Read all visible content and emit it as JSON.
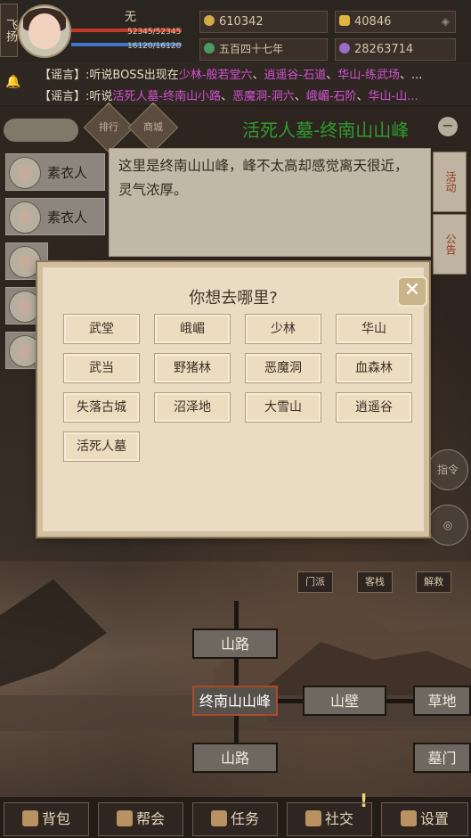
{
  "player": {
    "tag": "飞扬",
    "name": "无",
    "hp_text": "52345/52345",
    "mp_text": "16120/16120",
    "hp_fraction": 1.0,
    "mp_fraction": 1.0
  },
  "currencies": {
    "coins": "610342",
    "ingots": "40846",
    "date": "五百四十七年",
    "points": "28263714"
  },
  "rumors": [
    {
      "prefix": "【谣言】:听说BOSS出现在",
      "locs": [
        "少林-般若堂六",
        "逍遥谷-石道",
        "华山-练武场"
      ],
      "suffix": "、..."
    },
    {
      "prefix": "【谣言】:听说",
      "locs": [
        "活死人墓-终南山小路",
        "恶魔洞-洞六",
        "峨嵋-石阶",
        "华山-山..."
      ],
      "suffix": ""
    }
  ],
  "nav": {
    "ranking": "排行",
    "shop": "商城"
  },
  "location_title": "活死人墓-终南山山峰",
  "npcs": [
    "素衣人",
    "素衣人"
  ],
  "description": "这里是终南山山峰，峰不太高却感觉离天很近，灵气浓厚。",
  "side_tabs": {
    "activity": "活动",
    "notice": "公告"
  },
  "round_buttons": {
    "command": "指令"
  },
  "modal": {
    "title": "你想去哪里?",
    "destinations": [
      "武堂",
      "峨嵋",
      "少林",
      "华山",
      "武当",
      "野猪林",
      "恶魔洞",
      "血森林",
      "失落古城",
      "沼泽地",
      "大雪山",
      "逍遥谷",
      "活死人墓"
    ]
  },
  "map_actions": [
    "门派",
    "客栈",
    "解救"
  ],
  "map": {
    "current": "终南山山峰",
    "north": "山路",
    "south": "山路",
    "east": "山壁",
    "far_east_top": "草地",
    "far_east_bottom": "墓门"
  },
  "menu": [
    "背包",
    "帮会",
    "任务",
    "社交",
    "设置"
  ],
  "colors": {
    "location_green": "#3bbd3b",
    "rumor_magenta": "#d452d4",
    "hp_red": "#c23a2c",
    "mp_blue": "#3f78c9"
  }
}
